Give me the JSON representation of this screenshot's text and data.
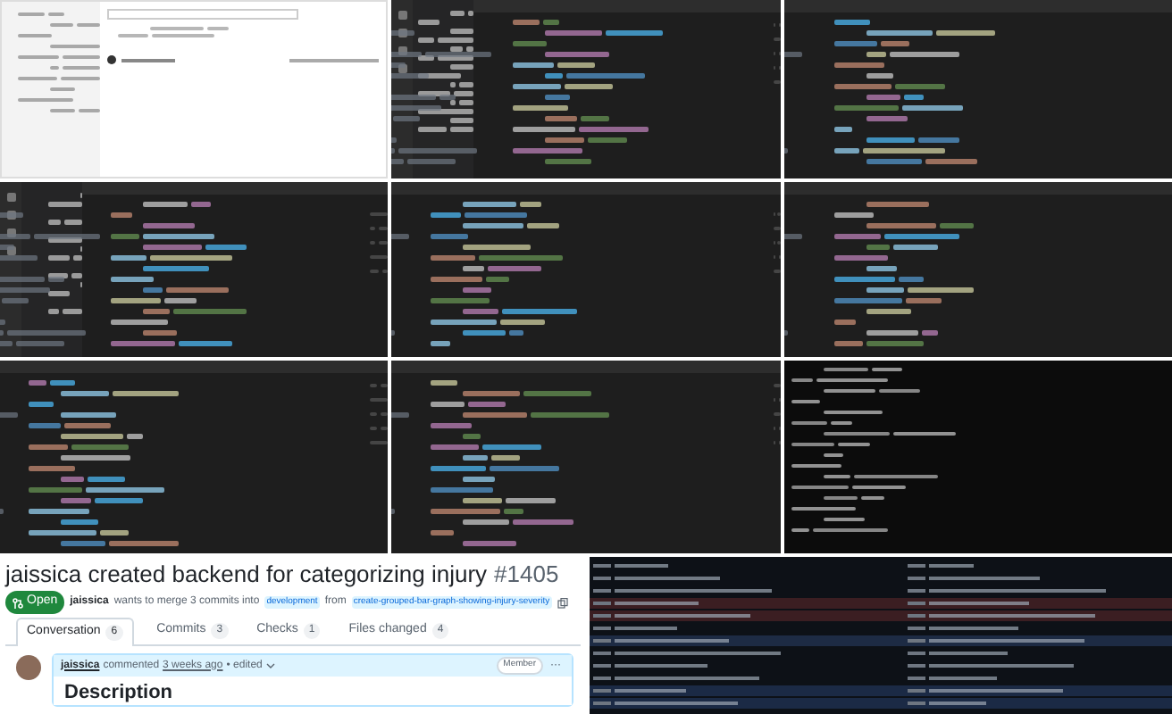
{
  "pull_request": {
    "title": "jaissica created backend for categorizing injury",
    "number": "#1405",
    "status": "Open",
    "summary": {
      "author": "jaissica",
      "text": "wants to merge 3 commits into",
      "base_branch": "development",
      "from": "from",
      "head_branch": "create-grouped-bar-graph-showing-injury-severity"
    },
    "tabs": [
      {
        "label": "Conversation",
        "count": "6",
        "selected": true
      },
      {
        "label": "Commits",
        "count": "3",
        "selected": false
      },
      {
        "label": "Checks",
        "count": "1",
        "selected": false
      },
      {
        "label": "Files changed",
        "count": "4",
        "selected": false
      }
    ],
    "comment": {
      "author": "jaissica",
      "action": "commented",
      "time": "3 weeks ago",
      "edited": "• edited",
      "role": "Member",
      "menu": "···",
      "heading": "Description"
    }
  }
}
